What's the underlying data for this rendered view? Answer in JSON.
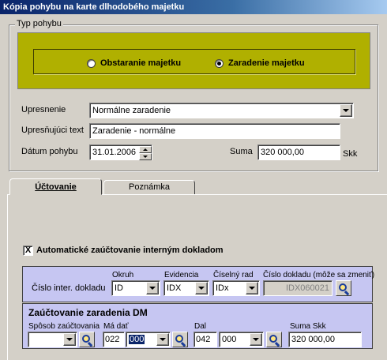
{
  "window": {
    "title": "Kópia pohybu na karte dlhodobého majetku"
  },
  "typ_pohybu": {
    "legend": "Typ pohybu",
    "options": [
      {
        "label": "Obstaranie majetku",
        "selected": false
      },
      {
        "label": "Zaradenie majetku",
        "selected": true
      }
    ]
  },
  "form": {
    "upresnenie_label": "Upresnenie",
    "upresnenie_value": "Normálne zaradenie",
    "upresnujuci_label": "Upresňujúci text",
    "upresnujuci_value": "Zaradenie - normálne",
    "datum_label": "Dátum pohybu",
    "datum_value": "31.01.2006",
    "suma_label": "Suma",
    "suma_value": "320 000,00",
    "currency": "Skk"
  },
  "tabs": [
    {
      "label": "Účtovanie",
      "active": true
    },
    {
      "label": "Poznámka",
      "active": false
    }
  ],
  "auto_checkbox": {
    "label": "Automatické zaúčtovanie interným dokladom",
    "checked": true,
    "mark": "X"
  },
  "doklad": {
    "row_label": "Číslo inter. dokladu",
    "headers": {
      "okruh": "Okruh",
      "evidencia": "Evidencia",
      "ciselny_rad": "Číselný rad",
      "cislo": "Číslo dokladu (môže sa zmeniť)"
    },
    "okruh": "ID",
    "evidencia": "IDX",
    "ciselny_rad": "IDx",
    "cislo": "IDX060021"
  },
  "zauctovanie": {
    "title": "Zaúčtovanie zaradenia DM",
    "sposob_label": "Spôsob zaúčtovania",
    "sposob_value": "",
    "ma_dat_label": "Má dať",
    "ma_dat_ucet": "022",
    "ma_dat_analytika": "000",
    "dal_label": "Dal",
    "dal_ucet": "042",
    "dal_analytika": "000",
    "suma_label": "Suma Skk",
    "suma_value": "320 000,00"
  },
  "colors": {
    "accent_panel": "#b0b000",
    "accounting_panel": "#c6c6f2",
    "titlebar": "#0a246a"
  }
}
